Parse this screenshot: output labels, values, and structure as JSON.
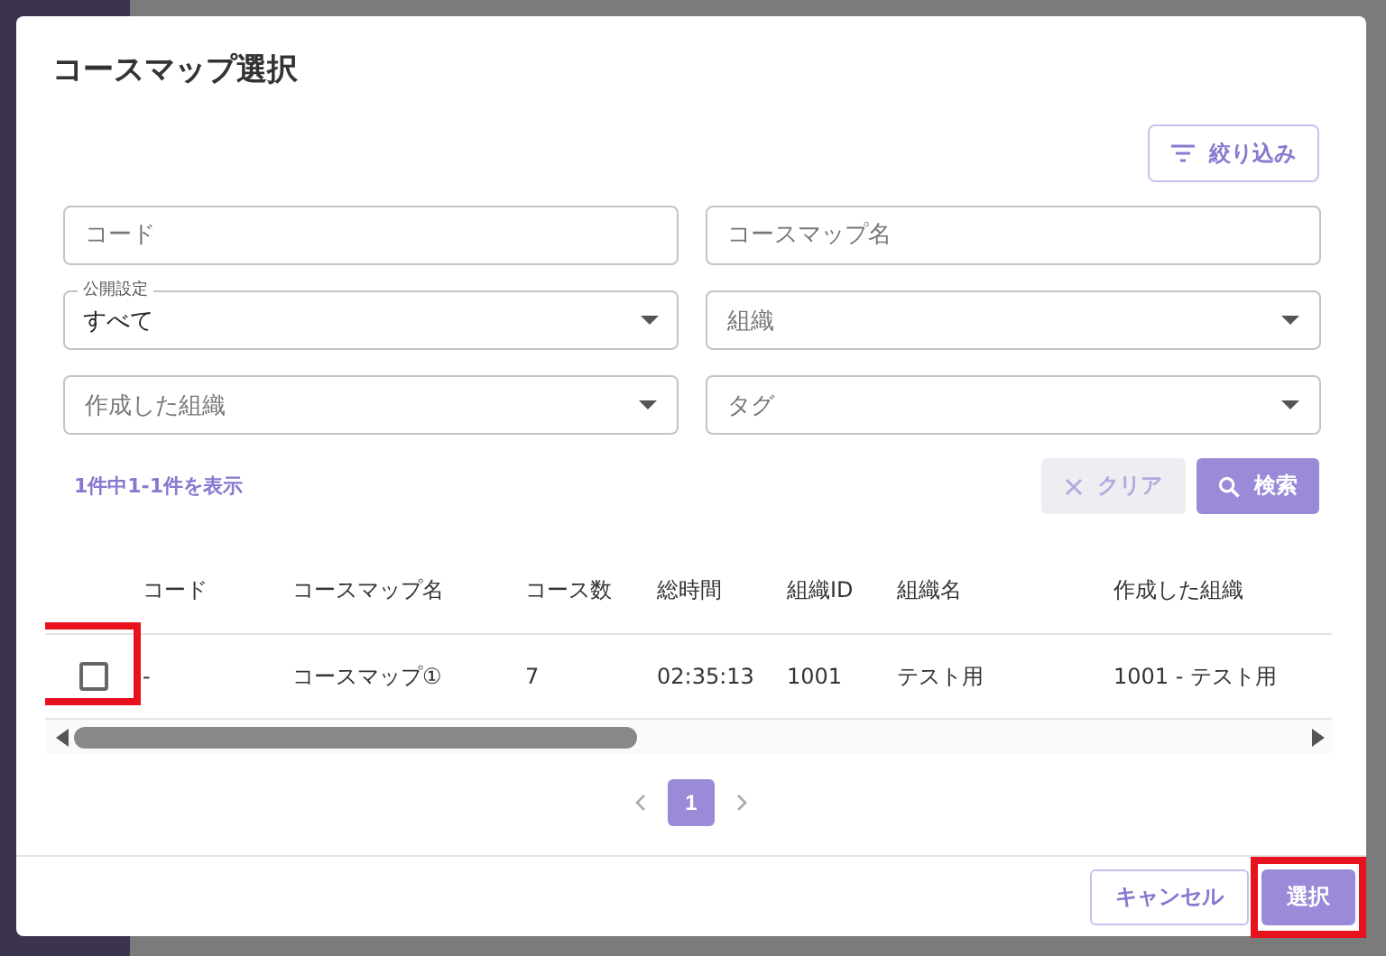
{
  "dialog": {
    "title": "コースマップ選択",
    "filter_button": "絞り込み",
    "fields": [
      {
        "kind": "text",
        "placeholder": "コード"
      },
      {
        "kind": "text",
        "placeholder": "コースマップ名"
      },
      {
        "kind": "select",
        "label": "公開設定",
        "value": "すべて"
      },
      {
        "kind": "select",
        "placeholder": "組織"
      },
      {
        "kind": "select",
        "placeholder": "作成した組織"
      },
      {
        "kind": "select",
        "placeholder": "タグ"
      }
    ],
    "result_count": "1件中1-1件を表示",
    "clear_button": {
      "label": "クリア",
      "disabled": true
    },
    "search_button": "検索",
    "table": {
      "columns": [
        "コード",
        "コースマップ名",
        "コース数",
        "総時間",
        "組織ID",
        "組織名",
        "作成した組織"
      ],
      "rows": [
        {
          "checked": false,
          "highlighted": true,
          "cells": [
            "-",
            "コースマップ①",
            "7",
            "02:35:13",
            "1001",
            "テスト用",
            "1001 - テスト用"
          ]
        }
      ]
    },
    "pagination": {
      "pages": [
        {
          "label": "1",
          "selected": true
        }
      ]
    },
    "footer": {
      "cancel_button": "キャンセル",
      "select_button": {
        "label": "選択",
        "highlighted": true
      }
    }
  }
}
